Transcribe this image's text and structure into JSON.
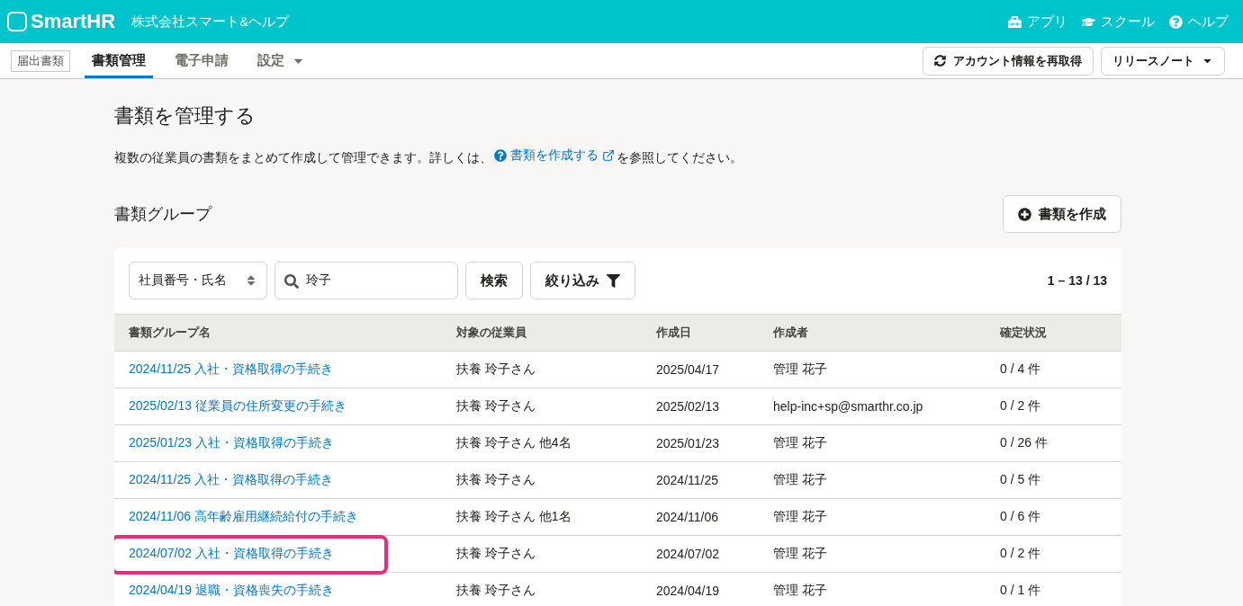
{
  "header": {
    "logo": "SmartHR",
    "company": "株式会社スマート&ヘルプ",
    "links": [
      {
        "kind": "app",
        "label": "アプリ"
      },
      {
        "kind": "school",
        "label": "スクール"
      },
      {
        "kind": "help",
        "label": "ヘルプ"
      }
    ]
  },
  "nav": {
    "badge": "届出書類",
    "tabs": [
      {
        "label": "書類管理",
        "selected": true,
        "dropdown": false
      },
      {
        "label": "電子申請",
        "selected": false,
        "dropdown": false
      },
      {
        "label": "設定",
        "selected": false,
        "dropdown": true
      }
    ],
    "refresh_button": "アカウント情報を再取得",
    "release_button": "リリースノート"
  },
  "page": {
    "title": "書類を管理する",
    "description_before": "複数の従業員の書類をまとめて作成して管理できます。詳しくは、",
    "help_link": "書類を作成する",
    "description_after": "を参照してください。",
    "section_title": "書類グループ",
    "create_button": "書類を作成"
  },
  "filters": {
    "select": "社員番号・氏名",
    "search_value": "玲子",
    "search_button": "検索",
    "filter_button": "絞り込み",
    "count": "1 – 13 / 13"
  },
  "table": {
    "columns": [
      "書類グループ名",
      "対象の従業員",
      "作成日",
      "作成者",
      "確定状況"
    ],
    "rows": [
      {
        "name": "2024/11/25 入社・資格取得の手続き",
        "employee": "扶養 玲子さん",
        "date": "2025/04/17",
        "author": "管理 花子",
        "status": "0 / 4 件",
        "highlighted": false
      },
      {
        "name": "2025/02/13 従業員の住所変更の手続き",
        "employee": "扶養 玲子さん",
        "date": "2025/02/13",
        "author": "help-inc+sp@smarthr.co.jp",
        "status": "0 / 2 件",
        "highlighted": false
      },
      {
        "name": "2025/01/23 入社・資格取得の手続き",
        "employee": "扶養 玲子さん 他4名",
        "date": "2025/01/23",
        "author": "管理 花子",
        "status": "0 / 26 件",
        "highlighted": false
      },
      {
        "name": "2024/11/25 入社・資格取得の手続き",
        "employee": "扶養 玲子さん",
        "date": "2024/11/25",
        "author": "管理 花子",
        "status": "0 / 5 件",
        "highlighted": false
      },
      {
        "name": "2024/11/06 高年齢雇用継続給付の手続き",
        "employee": "扶養 玲子さん 他1名",
        "date": "2024/11/06",
        "author": "管理 花子",
        "status": "0 / 6 件",
        "highlighted": false
      },
      {
        "name": "2024/07/02 入社・資格取得の手続き",
        "employee": "扶養 玲子さん",
        "date": "2024/07/02",
        "author": "管理 花子",
        "status": "0 / 2 件",
        "highlighted": true
      },
      {
        "name": "2024/04/19 退職・資格喪失の手続き",
        "employee": "扶養 玲子さん",
        "date": "2024/04/19",
        "author": "管理 花子",
        "status": "0 / 1 件",
        "highlighted": false
      }
    ]
  }
}
